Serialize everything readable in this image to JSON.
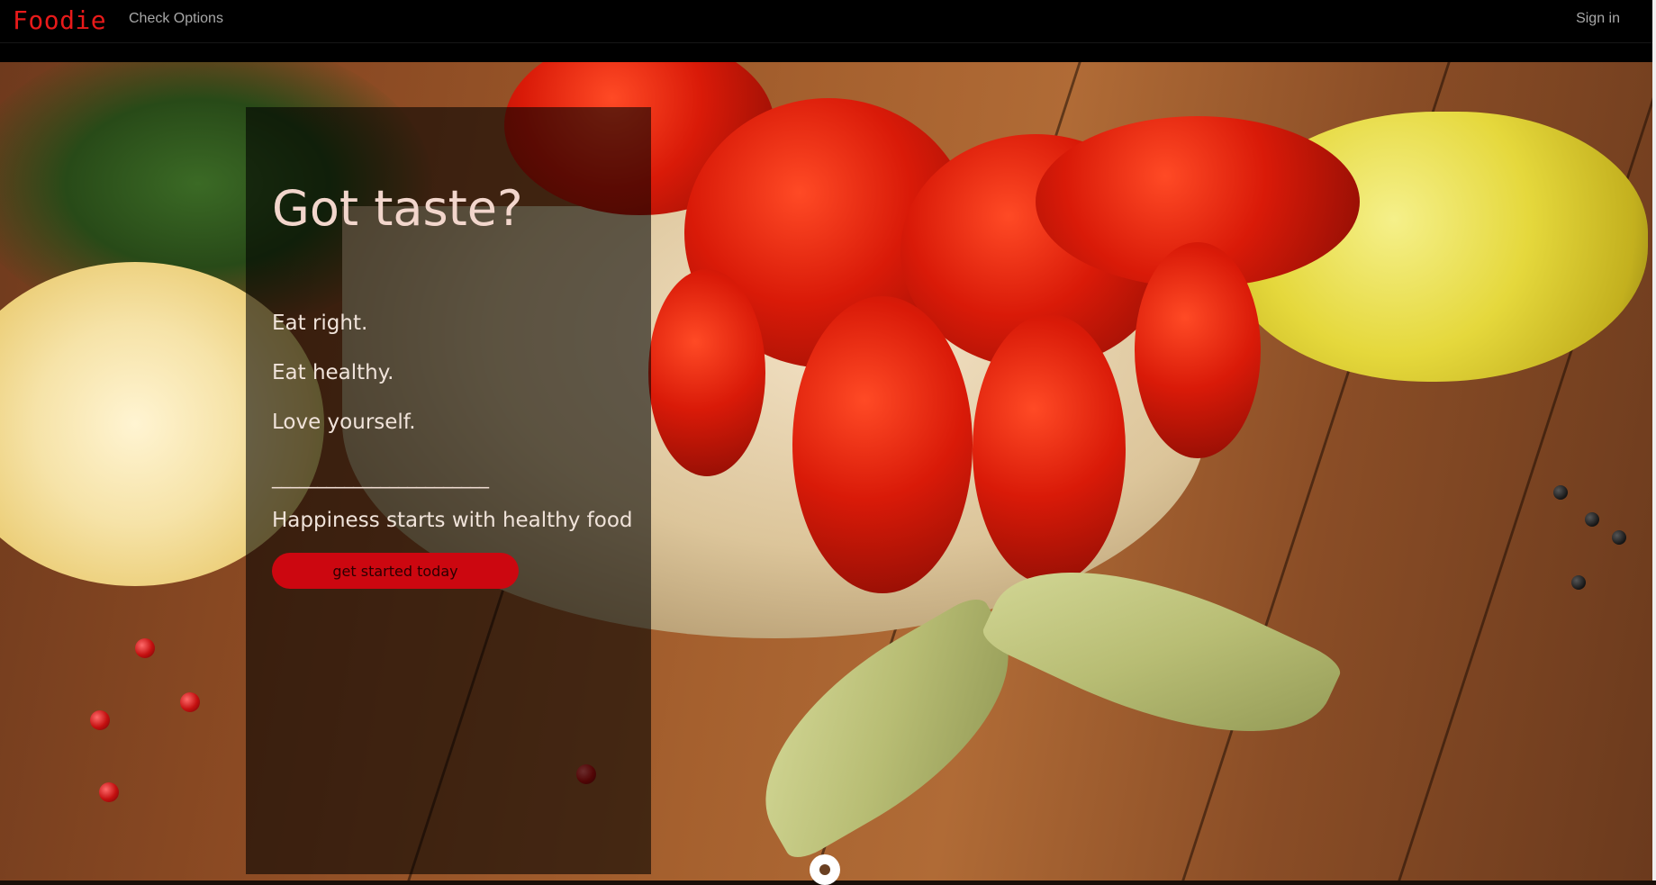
{
  "navbar": {
    "brand": "Foodie",
    "links": [
      {
        "label": "Check Options"
      }
    ],
    "sign_in": "Sign in"
  },
  "hero": {
    "headline": "Got taste?",
    "taglines": [
      "Eat right.",
      "Eat healthy.",
      "Love yourself."
    ],
    "divider": "________________________",
    "subheadline": "Happiness starts with healthy food",
    "cta_label": "get started today",
    "scroll_icon": "scroll-down-indicator-icon",
    "background_image": "crawfish-bowl-with-lemons-photo"
  },
  "colors": {
    "brand": "#e81a1a",
    "cta_background": "#cc0710",
    "navbar_background": "#000000",
    "overlay": "rgba(0,0,0,0.58)"
  }
}
